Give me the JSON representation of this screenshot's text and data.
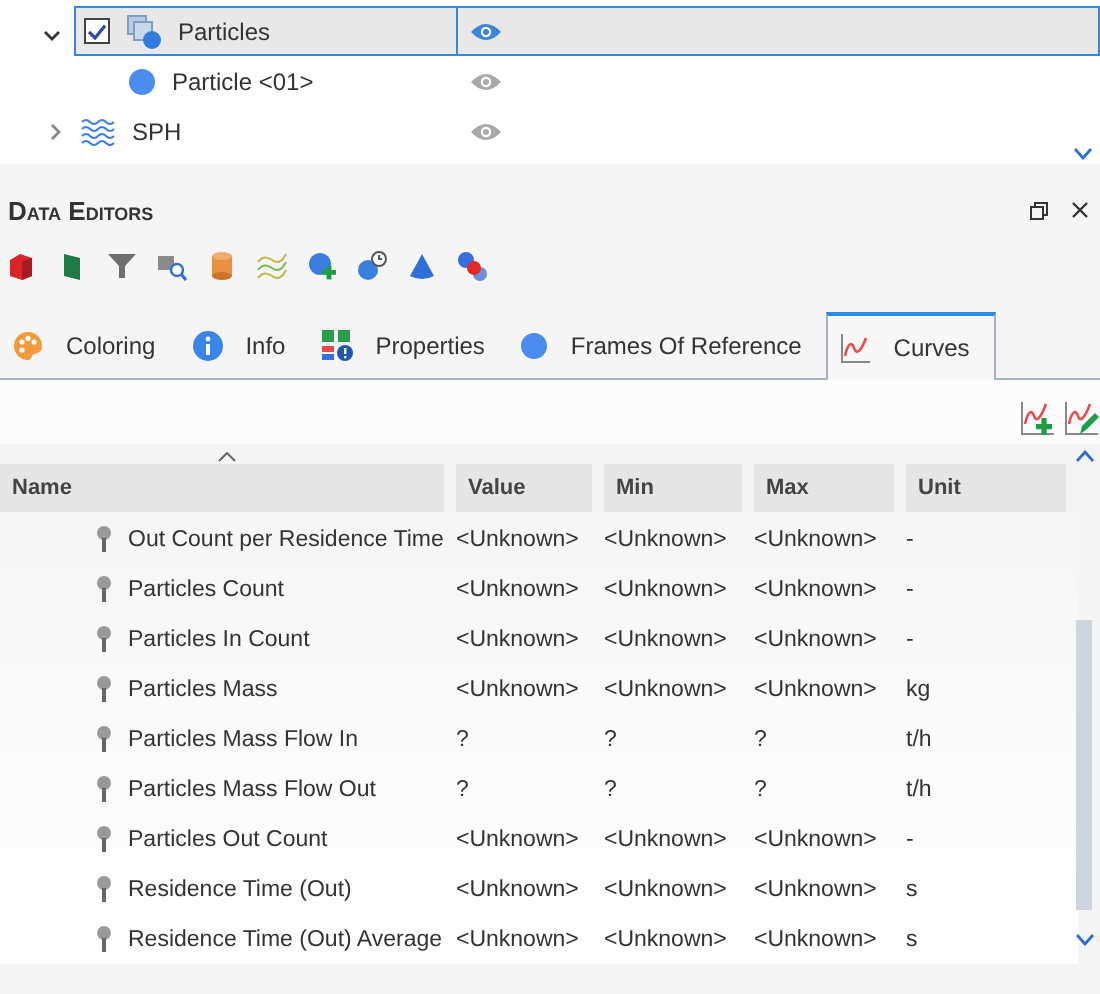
{
  "tree": [
    {
      "label": "Particles",
      "kind": "particles",
      "expanded": true,
      "checked": true,
      "selected": true,
      "visible": true,
      "children": [
        {
          "label": "Particle <01>",
          "kind": "particle",
          "selected": false,
          "visible": false
        }
      ]
    },
    {
      "label": "SPH",
      "kind": "sph",
      "expanded": false,
      "selected": false,
      "visible": false
    }
  ],
  "panel": {
    "title": "Data Editors"
  },
  "tabs": [
    {
      "label": "Coloring",
      "kind": "palette",
      "selected": false
    },
    {
      "label": "Info",
      "kind": "info",
      "selected": false
    },
    {
      "label": "Properties",
      "kind": "properties",
      "selected": false
    },
    {
      "label": "Frames Of Reference",
      "kind": "dot",
      "selected": false
    },
    {
      "label": "Curves",
      "kind": "curve",
      "selected": true
    }
  ],
  "table": {
    "columns": [
      "Name",
      "Value",
      "Min",
      "Max",
      "Unit"
    ],
    "rows": [
      [
        "Out Count per Residence Time",
        "<Unknown>",
        "<Unknown>",
        "<Unknown>",
        "-"
      ],
      [
        "Particles Count",
        "<Unknown>",
        "<Unknown>",
        "<Unknown>",
        "-"
      ],
      [
        "Particles In Count",
        "<Unknown>",
        "<Unknown>",
        "<Unknown>",
        "-"
      ],
      [
        "Particles Mass",
        "<Unknown>",
        "<Unknown>",
        "<Unknown>",
        "kg"
      ],
      [
        "Particles Mass Flow In",
        "?",
        "?",
        "?",
        "t/h"
      ],
      [
        "Particles Mass Flow Out",
        "?",
        "?",
        "?",
        "t/h"
      ],
      [
        "Particles Out Count",
        "<Unknown>",
        "<Unknown>",
        "<Unknown>",
        "-"
      ],
      [
        "Residence Time (Out)",
        "<Unknown>",
        "<Unknown>",
        "<Unknown>",
        "s"
      ],
      [
        "Residence Time (Out) Average",
        "<Unknown>",
        "<Unknown>",
        "<Unknown>",
        "s"
      ]
    ]
  }
}
